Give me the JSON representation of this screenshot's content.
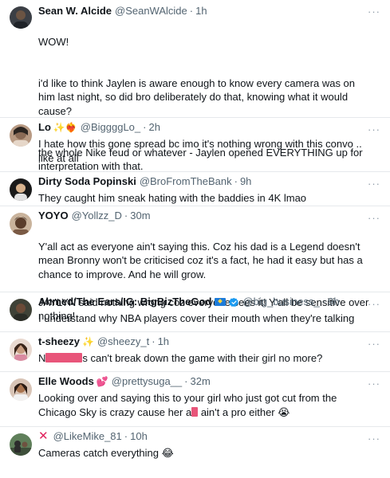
{
  "tweets": [
    {
      "name": "Sean W. Alcide",
      "handle": "@SeanWAlcide",
      "time": "1h",
      "text": [
        "WOW!",
        "i'd like to think Jaylen is aware enough to know every camera was on him last night, so did bro deliberately do that, knowing what it would cause?",
        "the whole Nike feud or whatever - Jaylen opened EVERYTHING up for interpretation with that."
      ],
      "more": "···"
    },
    {
      "name": "Lo",
      "name_emojis": "✨❤️‍🔥",
      "handle": "@BiggggLo_",
      "time": "2h",
      "text": "I hate how this gone spread bc imo it's nothing wrong with this convo .. like at all",
      "more": "···"
    },
    {
      "name": "Dirty Soda Popinski",
      "handle": "@BroFromTheBank",
      "time": "9h",
      "text": "They caught him sneak hating with the baddies in 4K lmao",
      "more": "···"
    },
    {
      "name": "YOYO",
      "handle": "@Yollzz_D",
      "time": "30m",
      "text": [
        "Y'all act as everyone ain't saying this. Coz his dad is a Legend doesn't mean Bronny won't be criticised coz it's a fact, he had it easy but has a chance to improve. And he will grow.",
        "JAYLYN said nothing wrong coz everyone sees it! Y'all be sensitive over nothing!"
      ],
      "more": "···"
    },
    {
      "name": "Ahmed/The Ears/IG: BigBizTheGod",
      "handle": "@big_business_",
      "time": "9h",
      "text": "I understand why NBA players cover their mouth when they're talking",
      "more": "···"
    },
    {
      "name": "t-sheezy",
      "name_emojis": "✨",
      "handle": "@sheezy_t",
      "time": "1h",
      "text_prefix": "N",
      "text_suffix": "s can't break down the game with their girl no more?",
      "more": "···"
    },
    {
      "name": "Elle Woods",
      "name_emojis": "💕",
      "handle": "@prettysuga__",
      "time": "32m",
      "text_prefix": "Looking over and saying this to your girl who just got cut from the Chicago Sky is crazy cause her a",
      "text_suffix": " ain't a pro either 😭",
      "more": "···"
    },
    {
      "name_icon": "✕",
      "handle": "@LikeMike_81",
      "time": "10h",
      "text": "Cameras catch everything 😂",
      "more": "···"
    }
  ],
  "separator": "·",
  "colors": {
    "text": "#0f1419",
    "muted": "#536471",
    "verified": "#1d9bf0",
    "redaction": "#e8557a",
    "divider": "#e6e9ec"
  }
}
